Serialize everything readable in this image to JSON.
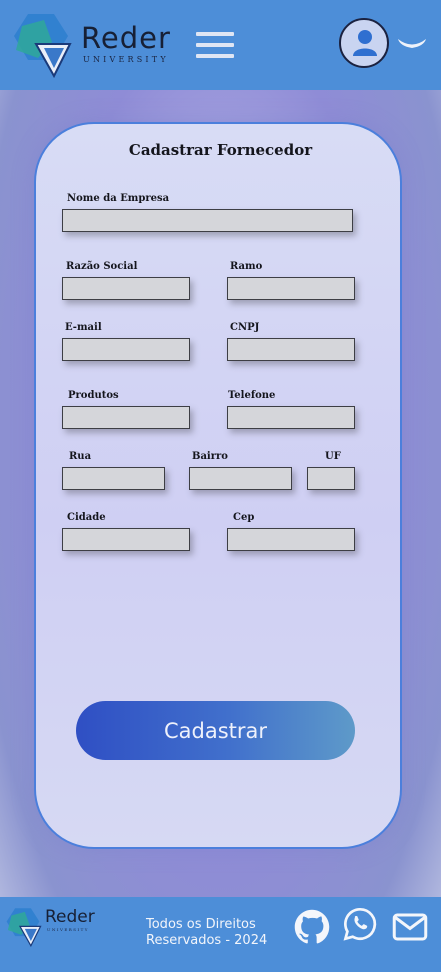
{
  "header": {
    "brand_name": "Reder",
    "brand_subtitle": "UNIVERSITY",
    "menu_icon": "hamburger-menu-icon",
    "avatar_icon": "user-icon",
    "dropdown_icon": "chevron-down-icon"
  },
  "form": {
    "title": "Cadastrar Fornecedor",
    "fields": {
      "empresa": {
        "label": "Nome da Empresa",
        "value": ""
      },
      "razao": {
        "label": "Razão Social",
        "value": ""
      },
      "ramo": {
        "label": "Ramo",
        "value": ""
      },
      "email": {
        "label": "E-mail",
        "value": ""
      },
      "cnpj": {
        "label": "CNPJ",
        "value": ""
      },
      "produtos": {
        "label": "Produtos",
        "value": ""
      },
      "telefone": {
        "label": "Telefone",
        "value": ""
      },
      "rua": {
        "label": "Rua",
        "value": ""
      },
      "bairro": {
        "label": "Bairro",
        "value": ""
      },
      "uf": {
        "label": "UF",
        "value": ""
      },
      "cidade": {
        "label": "Cidade",
        "value": ""
      },
      "cep": {
        "label": "Cep",
        "value": ""
      }
    },
    "submit_label": "Cadastrar"
  },
  "footer": {
    "brand_name": "Reder",
    "brand_subtitle": "UNIVERSITY",
    "copyright_line1": "Todos os Direitos",
    "copyright_line2": "Reservados - 2024",
    "social_icons": [
      "github-icon",
      "whatsapp-icon",
      "mail-icon"
    ]
  },
  "colors": {
    "bar": "#4d8ed8",
    "card_border": "#4b7fdc",
    "button_start": "#2f4fc4",
    "button_end": "#5e9ac9"
  }
}
